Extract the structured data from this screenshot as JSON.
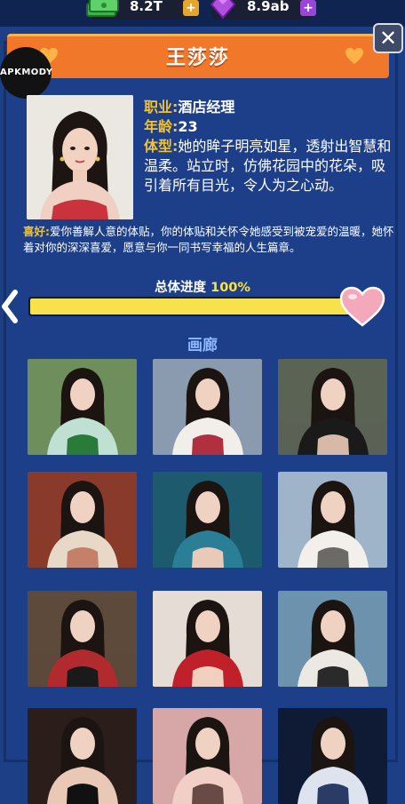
{
  "resources": {
    "cash": "8.2T",
    "gems": "8.9ab",
    "plus": "+"
  },
  "watermark": "APKMODY",
  "header": {
    "name": "王莎莎",
    "close": "✕"
  },
  "profile": {
    "occupation_label": "职业:",
    "occupation": "酒店经理",
    "age_label": "年龄:",
    "age": "23",
    "figure_label": "体型:",
    "figure": "她的眸子明亮如星，透射出智慧和温柔。站立时，仿佛花园中的花朵，吸引着所有目光，令人为之心动。",
    "hobby_label": "喜好:",
    "hobby": "爱你善解人意的体贴，你的体贴和关怀令她感受到被宠爱的温暖，她怀着对你的深深喜爱，愿意与你一同书写幸福的人生篇章。"
  },
  "progress": {
    "label": "总体进度",
    "percent_text": "100%",
    "fraction": 1.0
  },
  "gallery": {
    "title": "画廊",
    "images": [
      {
        "scene": "mint-dress-garden"
      },
      {
        "scene": "white-hood-flowers"
      },
      {
        "scene": "black-lace-indoor"
      },
      {
        "scene": "red-curtain-room"
      },
      {
        "scene": "underwater"
      },
      {
        "scene": "white-top-outdoor"
      },
      {
        "scene": "red-qipao-hall"
      },
      {
        "scene": "red-roses"
      },
      {
        "scene": "white-top-beach"
      },
      {
        "scene": "dark-portrait"
      },
      {
        "scene": "pink-wall"
      },
      {
        "scene": "night-moon"
      }
    ]
  },
  "colors": {
    "accent_orange": "#f1782b",
    "label_gold": "#f2c231",
    "progress_yellow": "#f8e24c",
    "panel_blue": "#1d3f8a"
  }
}
